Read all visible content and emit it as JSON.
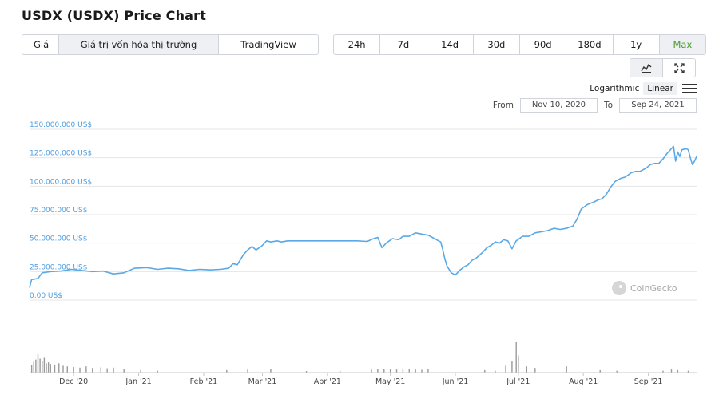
{
  "title": "USDX (USDX) Price Chart",
  "view_tabs": [
    "Giá",
    "Giá trị vốn hóa thị trường",
    "TradingView"
  ],
  "view_active": 1,
  "range_tabs": [
    "24h",
    "7d",
    "14d",
    "30d",
    "90d",
    "180d",
    "1y",
    "Max"
  ],
  "range_active": 7,
  "icons": {
    "line_chart": "line-chart-icon",
    "fullscreen": "expand-icon",
    "menu": "menu-icon"
  },
  "scale": {
    "log_label": "Logarithmic",
    "linear_label": "Linear",
    "active": "Linear"
  },
  "date_range": {
    "from_label": "From",
    "from_value": "Nov 10, 2020",
    "to_label": "To",
    "to_value": "Sep 24, 2021"
  },
  "watermark": "CoinGecko",
  "colors": {
    "line": "#5aa9e6",
    "axis_label": "#4f9ee0",
    "selected_range": "#4a9d2c",
    "volume": "#9a9a9a"
  },
  "chart_data": {
    "type": "line",
    "title": "",
    "xlabel": "",
    "ylabel": "",
    "y_tick_labels": [
      "150.000.000 US$",
      "125.000.000 US$",
      "100.000.000 US$",
      "75.000.000 US$",
      "50.000.000 US$",
      "25.000.000 US$",
      "0,00 US$"
    ],
    "ylim": [
      0,
      150000000
    ],
    "x_tick_labels": [
      "Dec '20",
      "Jan '21",
      "Feb '21",
      "Mar '21",
      "Apr '21",
      "May '21",
      "Jun '21",
      "Jul '21",
      "Aug '21",
      "Sep '21"
    ],
    "x_tick_dates": [
      "2020-12-01",
      "2021-01-01",
      "2021-02-01",
      "2021-03-01",
      "2021-04-01",
      "2021-05-01",
      "2021-06-01",
      "2021-07-01",
      "2021-08-01",
      "2021-09-01"
    ],
    "xlim": [
      "2020-11-10",
      "2021-09-24"
    ],
    "grid": true,
    "legend": "none",
    "series": [
      {
        "values": [
          [
            "2020-11-10",
            11000000
          ],
          [
            "2020-11-11",
            18000000
          ],
          [
            "2020-11-14",
            19000000
          ],
          [
            "2020-11-16",
            24000000
          ],
          [
            "2020-11-20",
            25000000
          ],
          [
            "2020-11-25",
            25500000
          ],
          [
            "2020-11-30",
            27000000
          ],
          [
            "2020-12-05",
            26000000
          ],
          [
            "2020-12-10",
            25000000
          ],
          [
            "2020-12-15",
            25500000
          ],
          [
            "2020-12-20",
            23000000
          ],
          [
            "2020-12-25",
            24000000
          ],
          [
            "2020-12-30",
            28000000
          ],
          [
            "2021-01-05",
            28500000
          ],
          [
            "2021-01-10",
            27000000
          ],
          [
            "2021-01-15",
            28000000
          ],
          [
            "2021-01-20",
            27500000
          ],
          [
            "2021-01-25",
            26000000
          ],
          [
            "2021-01-30",
            27000000
          ],
          [
            "2021-02-04",
            26500000
          ],
          [
            "2021-02-09",
            27000000
          ],
          [
            "2021-02-13",
            28000000
          ],
          [
            "2021-02-15",
            32000000
          ],
          [
            "2021-02-17",
            31000000
          ],
          [
            "2021-02-20",
            40000000
          ],
          [
            "2021-02-22",
            44000000
          ],
          [
            "2021-02-24",
            47000000
          ],
          [
            "2021-02-26",
            44000000
          ],
          [
            "2021-03-01",
            48000000
          ],
          [
            "2021-03-03",
            52000000
          ],
          [
            "2021-03-05",
            51000000
          ],
          [
            "2021-03-08",
            52000000
          ],
          [
            "2021-03-10",
            51000000
          ],
          [
            "2021-03-13",
            52000000
          ],
          [
            "2021-04-15",
            52000000
          ],
          [
            "2021-04-20",
            51500000
          ],
          [
            "2021-04-23",
            54000000
          ],
          [
            "2021-04-25",
            55000000
          ],
          [
            "2021-04-27",
            46000000
          ],
          [
            "2021-04-29",
            50000000
          ],
          [
            "2021-05-02",
            54000000
          ],
          [
            "2021-05-05",
            53000000
          ],
          [
            "2021-05-07",
            56000000
          ],
          [
            "2021-05-10",
            56000000
          ],
          [
            "2021-05-13",
            59000000
          ],
          [
            "2021-05-16",
            58000000
          ],
          [
            "2021-05-19",
            57000000
          ],
          [
            "2021-05-21",
            55000000
          ],
          [
            "2021-05-23",
            53000000
          ],
          [
            "2021-05-25",
            51000000
          ],
          [
            "2021-05-26",
            44000000
          ],
          [
            "2021-05-27",
            36000000
          ],
          [
            "2021-05-28",
            30000000
          ],
          [
            "2021-05-30",
            24000000
          ],
          [
            "2021-06-01",
            22000000
          ],
          [
            "2021-06-03",
            26000000
          ],
          [
            "2021-06-05",
            29000000
          ],
          [
            "2021-06-07",
            31000000
          ],
          [
            "2021-06-09",
            35000000
          ],
          [
            "2021-06-11",
            37000000
          ],
          [
            "2021-06-14",
            42000000
          ],
          [
            "2021-06-16",
            46000000
          ],
          [
            "2021-06-18",
            48000000
          ],
          [
            "2021-06-20",
            51000000
          ],
          [
            "2021-06-22",
            50000000
          ],
          [
            "2021-06-24",
            53000000
          ],
          [
            "2021-06-26",
            52000000
          ],
          [
            "2021-06-28",
            45000000
          ],
          [
            "2021-06-30",
            52000000
          ],
          [
            "2021-07-03",
            56000000
          ],
          [
            "2021-07-06",
            56000000
          ],
          [
            "2021-07-09",
            59000000
          ],
          [
            "2021-07-12",
            60000000
          ],
          [
            "2021-07-15",
            61000000
          ],
          [
            "2021-07-18",
            63000000
          ],
          [
            "2021-07-21",
            62000000
          ],
          [
            "2021-07-24",
            63000000
          ],
          [
            "2021-07-27",
            65000000
          ],
          [
            "2021-07-29",
            71000000
          ],
          [
            "2021-07-31",
            80000000
          ],
          [
            "2021-08-03",
            84000000
          ],
          [
            "2021-08-06",
            86000000
          ],
          [
            "2021-08-08",
            88000000
          ],
          [
            "2021-08-10",
            89000000
          ],
          [
            "2021-08-12",
            93000000
          ],
          [
            "2021-08-14",
            99000000
          ],
          [
            "2021-08-16",
            104000000
          ],
          [
            "2021-08-19",
            107000000
          ],
          [
            "2021-08-21",
            108000000
          ],
          [
            "2021-08-24",
            112000000
          ],
          [
            "2021-08-26",
            113000000
          ],
          [
            "2021-08-28",
            113000000
          ],
          [
            "2021-08-31",
            116000000
          ],
          [
            "2021-09-02",
            119000000
          ],
          [
            "2021-09-04",
            120000000
          ],
          [
            "2021-09-06",
            120000000
          ],
          [
            "2021-09-08",
            124000000
          ],
          [
            "2021-09-10",
            129000000
          ],
          [
            "2021-09-12",
            133000000
          ],
          [
            "2021-09-13",
            135000000
          ],
          [
            "2021-09-14",
            122000000
          ],
          [
            "2021-09-15",
            130000000
          ],
          [
            "2021-09-16",
            126000000
          ],
          [
            "2021-09-17",
            132000000
          ],
          [
            "2021-09-19",
            133000000
          ],
          [
            "2021-09-20",
            132000000
          ],
          [
            "2021-09-21",
            125000000
          ],
          [
            "2021-09-22",
            119000000
          ],
          [
            "2021-09-23",
            122000000
          ],
          [
            "2021-09-24",
            126000000
          ]
        ]
      }
    ],
    "volume": [
      [
        "2020-11-11",
        0.25
      ],
      [
        "2020-11-12",
        0.35
      ],
      [
        "2020-11-13",
        0.42
      ],
      [
        "2020-11-14",
        0.6
      ],
      [
        "2020-11-15",
        0.45
      ],
      [
        "2020-11-16",
        0.38
      ],
      [
        "2020-11-17",
        0.5
      ],
      [
        "2020-11-18",
        0.3
      ],
      [
        "2020-11-19",
        0.33
      ],
      [
        "2020-11-20",
        0.28
      ],
      [
        "2020-11-22",
        0.26
      ],
      [
        "2020-11-24",
        0.3
      ],
      [
        "2020-11-26",
        0.22
      ],
      [
        "2020-11-28",
        0.2
      ],
      [
        "2020-12-01",
        0.18
      ],
      [
        "2020-12-04",
        0.16
      ],
      [
        "2020-12-07",
        0.2
      ],
      [
        "2020-12-10",
        0.15
      ],
      [
        "2020-12-14",
        0.17
      ],
      [
        "2020-12-17",
        0.14
      ],
      [
        "2020-12-20",
        0.16
      ],
      [
        "2020-12-25",
        0.12
      ],
      [
        "2021-01-02",
        0.08
      ],
      [
        "2021-01-10",
        0.06
      ],
      [
        "2021-02-12",
        0.08
      ],
      [
        "2021-02-22",
        0.1
      ],
      [
        "2021-03-05",
        0.12
      ],
      [
        "2021-03-22",
        0.05
      ],
      [
        "2021-04-07",
        0.06
      ],
      [
        "2021-04-22",
        0.1
      ],
      [
        "2021-04-25",
        0.11
      ],
      [
        "2021-04-28",
        0.12
      ],
      [
        "2021-05-01",
        0.12
      ],
      [
        "2021-05-04",
        0.1
      ],
      [
        "2021-05-07",
        0.11
      ],
      [
        "2021-05-10",
        0.12
      ],
      [
        "2021-05-13",
        0.1
      ],
      [
        "2021-05-16",
        0.09
      ],
      [
        "2021-05-19",
        0.12
      ],
      [
        "2021-06-15",
        0.08
      ],
      [
        "2021-06-20",
        0.06
      ],
      [
        "2021-06-25",
        0.22
      ],
      [
        "2021-06-28",
        0.36
      ],
      [
        "2021-06-30",
        1.0
      ],
      [
        "2021-07-01",
        0.55
      ],
      [
        "2021-07-05",
        0.2
      ],
      [
        "2021-07-09",
        0.15
      ],
      [
        "2021-07-24",
        0.2
      ],
      [
        "2021-08-09",
        0.08
      ],
      [
        "2021-08-17",
        0.06
      ],
      [
        "2021-09-08",
        0.06
      ],
      [
        "2021-09-12",
        0.1
      ],
      [
        "2021-09-15",
        0.08
      ],
      [
        "2021-09-20",
        0.06
      ]
    ]
  }
}
